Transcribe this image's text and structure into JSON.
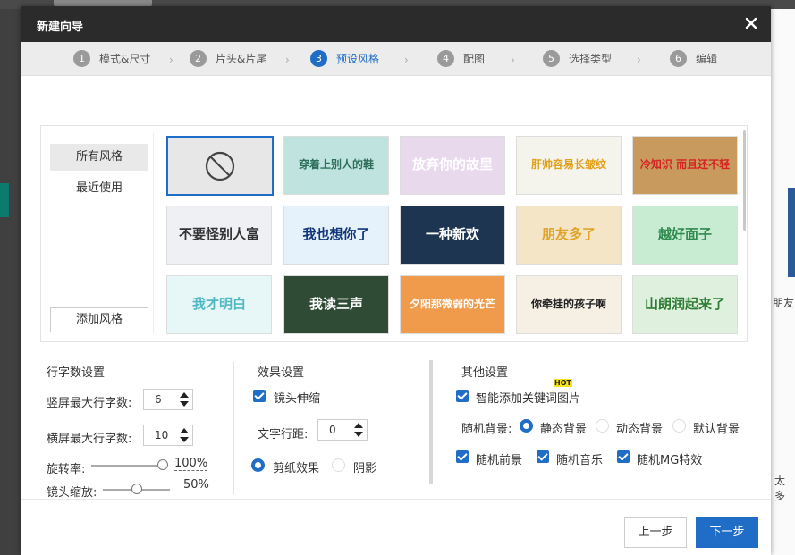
{
  "dialog": {
    "title": "新建向导"
  },
  "steps": [
    {
      "num": "1",
      "label": "模式&尺寸"
    },
    {
      "num": "2",
      "label": "片头&片尾"
    },
    {
      "num": "3",
      "label": "预设风格"
    },
    {
      "num": "4",
      "label": "配图"
    },
    {
      "num": "5",
      "label": "选择类型"
    },
    {
      "num": "6",
      "label": "编辑"
    }
  ],
  "sidebar": {
    "all_styles": "所有风格",
    "recent": "最近使用",
    "add_style": "添加风格"
  },
  "thumbnails": [
    {
      "text": "",
      "bg": "#e7e7e7",
      "color": "#555"
    },
    {
      "text": "穿着上别人的鞋",
      "bg": "#bfe3df",
      "color": "#2e6f5a"
    },
    {
      "text": "放弃你的故里",
      "bg": "#e9d9ec",
      "color": "#fff"
    },
    {
      "text": "肝帅容易长皱纹",
      "bg": "#f4f4ec",
      "color": "#e2a11a"
    },
    {
      "text": "冷知识 而且还不轻",
      "bg": "#c99a5d",
      "color": "#d62222"
    },
    {
      "text": "不要怪别人富",
      "bg": "#eef0f4",
      "color": "#333"
    },
    {
      "text": "我也想你了",
      "bg": "#e6f2fb",
      "color": "#10357a"
    },
    {
      "text": "一种新欢",
      "bg": "#1e3552",
      "color": "#fff"
    },
    {
      "text": "朋友多了",
      "bg": "#f3e5c6",
      "color": "#e1a42b"
    },
    {
      "text": "越好面子",
      "bg": "#c8ecd2",
      "color": "#2f8a4f"
    },
    {
      "text": "我才明白",
      "bg": "#e7f6f7",
      "color": "#52b9c4"
    },
    {
      "text": "我读三声",
      "bg": "#2f4a35",
      "color": "#fff"
    },
    {
      "text": "夕阳那微弱的光芒",
      "bg": "#f09a4b",
      "color": "#fff"
    },
    {
      "text": "你牵挂的孩子啊",
      "bg": "#f6efe4",
      "color": "#222"
    },
    {
      "text": "山朗润起来了",
      "bg": "#dff0df",
      "color": "#2e7d32"
    }
  ],
  "rows_settings": {
    "title": "行字数设置",
    "portrait_label": "竖屏最大行字数:",
    "portrait_value": "6",
    "landscape_label": "横屏最大行字数:",
    "landscape_value": "10",
    "rotation_label": "旋转率:",
    "rotation_value": "100%",
    "rotation_level": 1.0,
    "zoom_label": "镜头缩放:",
    "zoom_value": "50%",
    "zoom_level": 0.5
  },
  "effects": {
    "title": "效果设置",
    "lens_stretch": "镜头伸缩",
    "line_spacing_label": "文字行距:",
    "line_spacing_value": "0",
    "paper_cut": "剪纸效果",
    "shadow": "阴影"
  },
  "other": {
    "title": "其他设置",
    "smart_keyword": "智能添加关键词图片",
    "hot_badge": "HOT",
    "random_bg_label": "随机背景:",
    "static_bg": "静态背景",
    "dynamic_bg": "动态背景",
    "default_bg": "默认背景",
    "random_fg": "随机前景",
    "random_music": "随机音乐",
    "random_mg": "随机MG特效"
  },
  "footer": {
    "prev": "上一步",
    "next": "下一步"
  },
  "background": {
    "right_text_1": "朋友",
    "right_text_2": "太多"
  },
  "colors": {
    "accent": "#1f6dc7",
    "titlebar": "#2b2b2b"
  }
}
